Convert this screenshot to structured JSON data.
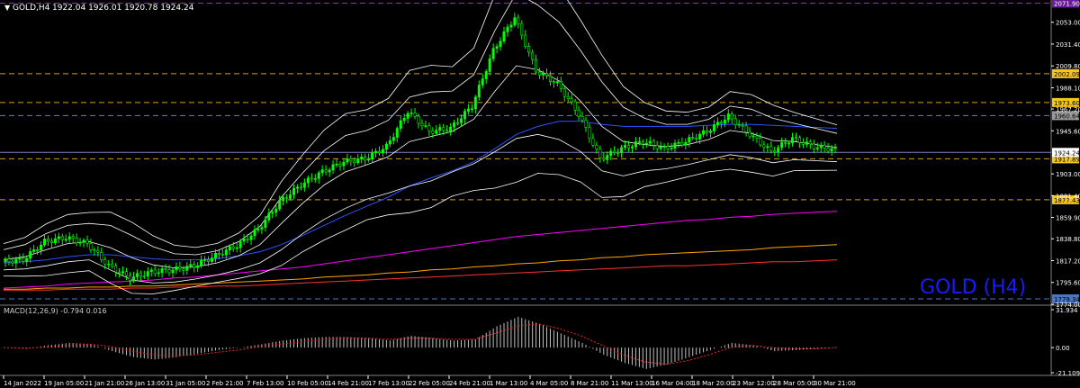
{
  "header": {
    "caret": "▼",
    "symbol": "GOLD,H4",
    "ohlc": "1922.04 1926.01 1920.78 1924.24"
  },
  "watermark": "GOLD (H4)",
  "colors": {
    "background": "#000000",
    "candle_up": "#00ff00",
    "bands": "#ffffff",
    "ma_blue": "#2f50ff",
    "ma_magenta": "#ff00ff",
    "ma_orange": "#ffa500",
    "ma_red": "#ff3030",
    "level_gold": "#d4a017",
    "level_blue": "#3050c0",
    "macd_signal": "#ff2020",
    "watermark": "#1a1aff"
  },
  "chart_data": {
    "type": "line",
    "title": "GOLD,H4",
    "y_ticks": [
      "2053.00",
      "2031.40",
      "2009.80",
      "1988.10",
      "1967.20",
      "1945.60",
      "1903.00",
      "1881.40",
      "1859.90",
      "1838.80",
      "1817.20",
      "1795.60",
      "1774.00"
    ],
    "y_range": [
      1774,
      2075
    ],
    "x_ticks": [
      "14 Jan 2022",
      "19 Jan 05:00",
      "21 Jan 21:00",
      "26 Jan 13:00",
      "31 Jan 05:00",
      "2 Feb 21:00",
      "7 Feb 13:00",
      "10 Feb 05:00",
      "14 Feb 21:00",
      "17 Feb 13:00",
      "22 Feb 05:00",
      "24 Feb 21:00",
      "1 Mar 13:00",
      "4 Mar 05:00",
      "8 Mar 21:00",
      "11 Mar 13:00",
      "16 Mar 04:00",
      "18 Mar 20:00",
      "23 Mar 12:00",
      "28 Mar 05:00",
      "30 Mar 21:00"
    ],
    "price_levels": [
      {
        "label": "2071.90",
        "value": 2071.9,
        "style": "purple"
      },
      {
        "label": "2002.09",
        "value": 2002.09,
        "style": "gold"
      },
      {
        "label": "1973.60",
        "value": 1973.6,
        "style": "gold"
      },
      {
        "label": "1960.64",
        "value": 1960.64,
        "style": "gray"
      },
      {
        "label": "1917.89",
        "value": 1917.89,
        "style": "gold"
      },
      {
        "label": "1877.43",
        "value": 1877.43,
        "style": "gold"
      },
      {
        "label": "1779.34",
        "value": 1779.34,
        "style": "blue"
      }
    ],
    "current_price": {
      "label": "1924.24",
      "value": 1924.24
    },
    "series": [
      {
        "name": "close",
        "values": [
          1816,
          1818,
          1836,
          1840,
          1834,
          1812,
          1800,
          1806,
          1808,
          1812,
          1822,
          1832,
          1848,
          1875,
          1892,
          1905,
          1915,
          1918,
          1930,
          1965,
          1945,
          1948,
          1970,
          2025,
          2058,
          2005,
          1992,
          1962,
          1918,
          1928,
          1935,
          1928,
          1935,
          1945,
          1960,
          1942,
          1925,
          1938,
          1930,
          1927
        ]
      },
      {
        "name": "ma_fast",
        "values": [
          1818,
          1821,
          1828,
          1834,
          1836,
          1830,
          1820,
          1813,
          1810,
          1811,
          1815,
          1822,
          1833,
          1854,
          1874,
          1892,
          1905,
          1912,
          1920,
          1935,
          1940,
          1945,
          1957,
          1985,
          2010,
          2006,
          1995,
          1975,
          1950,
          1935,
          1932,
          1930,
          1932,
          1937,
          1946,
          1943,
          1936,
          1935,
          1932,
          1929
        ]
      },
      {
        "name": "ma_mid",
        "values": [
          1815,
          1816,
          1818,
          1821,
          1823,
          1823,
          1821,
          1819,
          1818,
          1818,
          1819,
          1822,
          1826,
          1833,
          1842,
          1852,
          1862,
          1871,
          1880,
          1891,
          1899,
          1906,
          1915,
          1928,
          1942,
          1950,
          1955,
          1955,
          1952,
          1950,
          1950,
          1950,
          1950,
          1951,
          1952,
          1952,
          1951,
          1950,
          1949,
          1948
        ]
      },
      {
        "name": "ma_slow1",
        "values": [
          1790,
          1791,
          1792,
          1794,
          1795,
          1796,
          1797,
          1798,
          1800,
          1801,
          1803,
          1805,
          1807,
          1809,
          1811,
          1814,
          1817,
          1820,
          1823,
          1826,
          1829,
          1832,
          1835,
          1838,
          1841,
          1843,
          1845,
          1847,
          1849,
          1851,
          1853,
          1855,
          1857,
          1858,
          1860,
          1861,
          1863,
          1864,
          1865,
          1866
        ]
      },
      {
        "name": "ma_slow2",
        "values": [
          1789,
          1789,
          1790,
          1790,
          1791,
          1791,
          1792,
          1792,
          1793,
          1794,
          1795,
          1796,
          1797,
          1798,
          1799,
          1801,
          1802,
          1803,
          1805,
          1806,
          1808,
          1809,
          1811,
          1812,
          1814,
          1815,
          1817,
          1818,
          1820,
          1821,
          1823,
          1824,
          1825,
          1826,
          1827,
          1828,
          1830,
          1831,
          1832,
          1833
        ]
      },
      {
        "name": "ma_slow3",
        "values": [
          1788,
          1788,
          1788,
          1789,
          1789,
          1789,
          1790,
          1790,
          1791,
          1791,
          1792,
          1792,
          1793,
          1794,
          1795,
          1796,
          1797,
          1798,
          1799,
          1800,
          1801,
          1802,
          1803,
          1804,
          1805,
          1806,
          1807,
          1808,
          1809,
          1810,
          1811,
          1812,
          1812,
          1813,
          1814,
          1815,
          1816,
          1816,
          1817,
          1818
        ]
      }
    ],
    "band_width": [
      10,
      12,
      16,
      18,
      18,
      22,
      22,
      18,
      14,
      12,
      12,
      14,
      18,
      26,
      30,
      34,
      36,
      34,
      36,
      44,
      44,
      40,
      44,
      60,
      72,
      64,
      58,
      50,
      44,
      34,
      26,
      22,
      20,
      20,
      24,
      24,
      22,
      18,
      16,
      14
    ],
    "macd": {
      "label": "MACD(12,26,9) -0.794 0.016",
      "y_ticks": [
        "31.934",
        "0.00",
        "-21.109"
      ],
      "y_range": [
        -21.109,
        31.934
      ],
      "values": [
        0,
        -1,
        2,
        4,
        3,
        -3,
        -8,
        -10,
        -8,
        -5,
        -2,
        0,
        3,
        6,
        8,
        9,
        9,
        8,
        6,
        10,
        8,
        6,
        7,
        18,
        26,
        20,
        12,
        4,
        -6,
        -13,
        -18,
        -14,
        -8,
        -2,
        4,
        2,
        -3,
        -2,
        -1,
        0.5
      ],
      "signal": [
        0,
        -0.5,
        0.5,
        2,
        3,
        1,
        -3,
        -6,
        -7,
        -6,
        -4,
        -2,
        1,
        3,
        5,
        7,
        8,
        8,
        7,
        8,
        8,
        7,
        7,
        12,
        18,
        20,
        16,
        10,
        2,
        -6,
        -12,
        -14,
        -11,
        -6,
        0,
        2,
        0,
        -1,
        -1,
        0
      ]
    }
  }
}
